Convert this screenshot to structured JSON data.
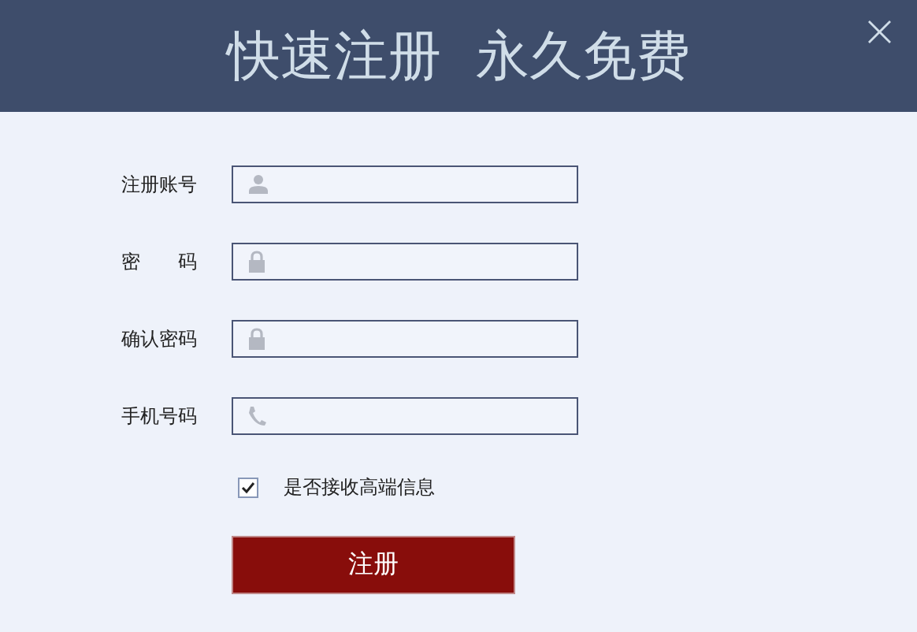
{
  "header": {
    "title": "快速注册  永久免费",
    "close": "×"
  },
  "fields": [
    {
      "label": "注册账号",
      "kind": "user"
    },
    {
      "label": "密　　码",
      "kind": "lock"
    },
    {
      "label": "确认密码",
      "kind": "lock"
    },
    {
      "label": "手机号码",
      "kind": "phone"
    }
  ],
  "option": {
    "label": "是否接收高端信息",
    "checked": true
  },
  "submit": "注册"
}
